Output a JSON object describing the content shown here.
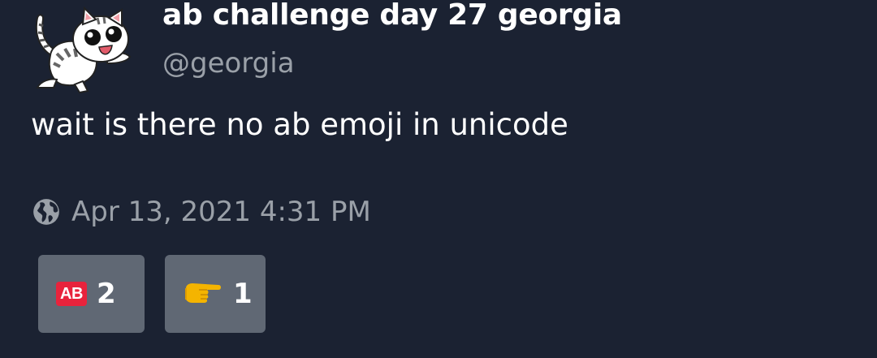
{
  "post": {
    "display_name": "ab challenge day 27 georgia",
    "handle": "@georgia",
    "content": "wait is there no ab emoji in unicode",
    "timestamp": "Apr 13, 2021 4:31 PM",
    "visibility_icon": "globe-icon",
    "avatar_icon": "cat-avatar"
  },
  "reactions": [
    {
      "emoji_icon": "ab-button-emoji",
      "emoji_label": "AB",
      "count": "2",
      "color": "#e8233c"
    },
    {
      "emoji_icon": "pointing-right-hand-emoji",
      "count": "1",
      "color": "#f4b400"
    }
  ],
  "colors": {
    "background": "#1b2232",
    "muted_text": "#9aa0a8",
    "reaction_bg": "#606874"
  }
}
